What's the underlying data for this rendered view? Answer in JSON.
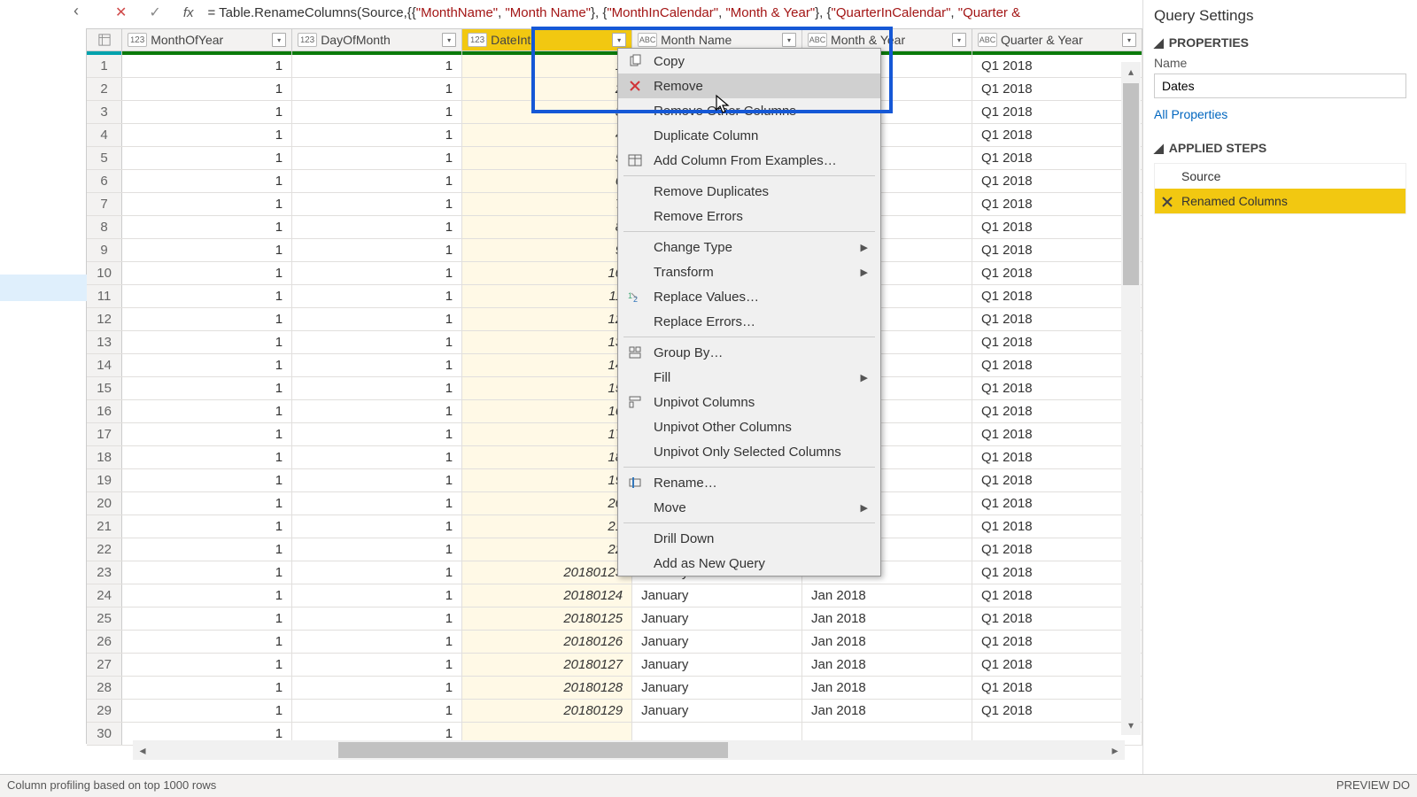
{
  "formula_bar": {
    "fx": "fx",
    "text_parts": [
      "= Table.RenameColumns(Source,{{",
      "\"MonthName\"",
      ", ",
      "\"Month Name\"",
      "}, {",
      "\"MonthInCalendar\"",
      ", ",
      "\"Month & Year\"",
      "}, {",
      "\"QuarterInCalendar\"",
      ", ",
      "\"Quarter &"
    ]
  },
  "columns": [
    {
      "name": "MonthOfYear",
      "type": "num",
      "w": "col-w0"
    },
    {
      "name": "DayOfMonth",
      "type": "num",
      "w": "col-w1"
    },
    {
      "name": "DateInt",
      "type": "num",
      "w": "col-w2",
      "selected": true
    },
    {
      "name": "Month Name",
      "type": "txt",
      "w": "col-w3"
    },
    {
      "name": "Month & Year",
      "type": "txt",
      "w": "col-w4"
    },
    {
      "name": "Quarter & Year",
      "type": "txt",
      "w": "col-w5"
    }
  ],
  "rows": [
    {
      "n": 1,
      "c": [
        "1",
        "1",
        "1",
        "",
        "Jan 2018",
        "Q1 2018"
      ]
    },
    {
      "n": 2,
      "c": [
        "1",
        "1",
        "2",
        "",
        "Jan 2018",
        "Q1 2018"
      ]
    },
    {
      "n": 3,
      "c": [
        "1",
        "1",
        "3",
        "",
        "Jan 2018",
        "Q1 2018"
      ]
    },
    {
      "n": 4,
      "c": [
        "1",
        "1",
        "4",
        "",
        "Jan 2018",
        "Q1 2018"
      ]
    },
    {
      "n": 5,
      "c": [
        "1",
        "1",
        "5",
        "",
        "Jan 2018",
        "Q1 2018"
      ]
    },
    {
      "n": 6,
      "c": [
        "1",
        "1",
        "6",
        "",
        "Jan 2018",
        "Q1 2018"
      ]
    },
    {
      "n": 7,
      "c": [
        "1",
        "1",
        "7",
        "",
        "Jan 2018",
        "Q1 2018"
      ]
    },
    {
      "n": 8,
      "c": [
        "1",
        "1",
        "8",
        "",
        "Jan 2018",
        "Q1 2018"
      ]
    },
    {
      "n": 9,
      "c": [
        "1",
        "1",
        "9",
        "",
        "Jan 2018",
        "Q1 2018"
      ]
    },
    {
      "n": 10,
      "c": [
        "1",
        "1",
        "10",
        "",
        "Jan 2018",
        "Q1 2018"
      ]
    },
    {
      "n": 11,
      "c": [
        "1",
        "1",
        "11",
        "",
        "Jan 2018",
        "Q1 2018"
      ]
    },
    {
      "n": 12,
      "c": [
        "1",
        "1",
        "12",
        "",
        "Jan 2018",
        "Q1 2018"
      ]
    },
    {
      "n": 13,
      "c": [
        "1",
        "1",
        "13",
        "",
        "Jan 2018",
        "Q1 2018"
      ]
    },
    {
      "n": 14,
      "c": [
        "1",
        "1",
        "14",
        "",
        "Jan 2018",
        "Q1 2018"
      ]
    },
    {
      "n": 15,
      "c": [
        "1",
        "1",
        "15",
        "",
        "Jan 2018",
        "Q1 2018"
      ]
    },
    {
      "n": 16,
      "c": [
        "1",
        "1",
        "16",
        "",
        "Jan 2018",
        "Q1 2018"
      ]
    },
    {
      "n": 17,
      "c": [
        "1",
        "1",
        "17",
        "",
        "Jan 2018",
        "Q1 2018"
      ]
    },
    {
      "n": 18,
      "c": [
        "1",
        "1",
        "18",
        "",
        "Jan 2018",
        "Q1 2018"
      ]
    },
    {
      "n": 19,
      "c": [
        "1",
        "1",
        "19",
        "",
        "Jan 2018",
        "Q1 2018"
      ]
    },
    {
      "n": 20,
      "c": [
        "1",
        "1",
        "20",
        "",
        "Jan 2018",
        "Q1 2018"
      ]
    },
    {
      "n": 21,
      "c": [
        "1",
        "1",
        "21",
        "",
        "Jan 2018",
        "Q1 2018"
      ]
    },
    {
      "n": 22,
      "c": [
        "1",
        "1",
        "22",
        "",
        "Jan 2018",
        "Q1 2018"
      ]
    },
    {
      "n": 23,
      "c": [
        "1",
        "1",
        "23",
        "20180123",
        "Jan 2018",
        "Q1 2018"
      ],
      "mn": "January"
    },
    {
      "n": 24,
      "c": [
        "1",
        "1",
        "24",
        "20180124",
        "Jan 2018",
        "Q1 2018"
      ],
      "mn": "January"
    },
    {
      "n": 25,
      "c": [
        "1",
        "1",
        "25",
        "20180125",
        "Jan 2018",
        "Q1 2018"
      ],
      "mn": "January"
    },
    {
      "n": 26,
      "c": [
        "1",
        "1",
        "26",
        "20180126",
        "Jan 2018",
        "Q1 2018"
      ],
      "mn": "January"
    },
    {
      "n": 27,
      "c": [
        "1",
        "1",
        "27",
        "20180127",
        "Jan 2018",
        "Q1 2018"
      ],
      "mn": "January"
    },
    {
      "n": 28,
      "c": [
        "1",
        "1",
        "28",
        "20180128",
        "Jan 2018",
        "Q1 2018"
      ],
      "mn": "January"
    },
    {
      "n": 29,
      "c": [
        "1",
        "1",
        "29",
        "20180129",
        "Jan 2018",
        "Q1 2018"
      ],
      "mn": "January"
    },
    {
      "n": 30,
      "c": [
        "1",
        "1",
        "",
        "",
        "",
        ""
      ],
      "mn": ""
    }
  ],
  "context_menu": {
    "items": [
      {
        "label": "Copy",
        "icon": "copy"
      },
      {
        "label": "Remove",
        "icon": "remove",
        "hover": true
      },
      {
        "label": "Remove Other Columns"
      },
      {
        "label": "Duplicate Column"
      },
      {
        "label": "Add Column From Examples…",
        "icon": "table"
      },
      {
        "sep": true
      },
      {
        "label": "Remove Duplicates"
      },
      {
        "label": "Remove Errors"
      },
      {
        "sep": true
      },
      {
        "label": "Change Type",
        "sub": true
      },
      {
        "label": "Transform",
        "sub": true
      },
      {
        "label": "Replace Values…",
        "icon": "replace"
      },
      {
        "label": "Replace Errors…"
      },
      {
        "sep": true
      },
      {
        "label": "Group By…",
        "icon": "group"
      },
      {
        "label": "Fill",
        "sub": true
      },
      {
        "label": "Unpivot Columns",
        "icon": "unpivot"
      },
      {
        "label": "Unpivot Other Columns"
      },
      {
        "label": "Unpivot Only Selected Columns"
      },
      {
        "sep": true
      },
      {
        "label": "Rename…",
        "icon": "rename"
      },
      {
        "label": "Move",
        "sub": true
      },
      {
        "sep": true
      },
      {
        "label": "Drill Down"
      },
      {
        "label": "Add as New Query"
      }
    ]
  },
  "right_panel": {
    "title": "Query Settings",
    "properties_h": "PROPERTIES",
    "name_label": "Name",
    "name_value": "Dates",
    "all_props": "All Properties",
    "applied_h": "APPLIED STEPS",
    "steps": [
      {
        "label": "Source"
      },
      {
        "label": "Renamed Columns",
        "sel": true,
        "xicon": true
      }
    ]
  },
  "status": {
    "left": "Column profiling based on top 1000 rows",
    "right": "PREVIEW DO"
  }
}
